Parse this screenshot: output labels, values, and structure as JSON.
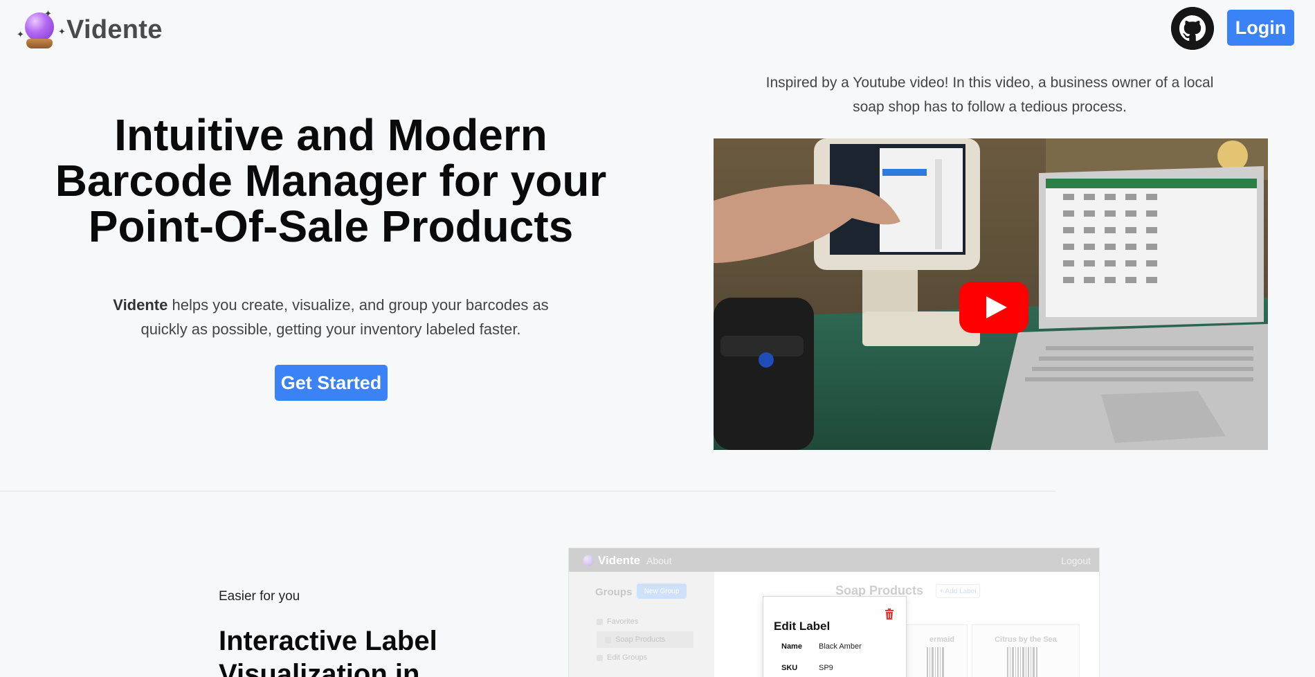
{
  "brand": {
    "name": "Vidente"
  },
  "header": {
    "login_label": "Login",
    "github_label": "GitHub"
  },
  "hero": {
    "title_lines": [
      "Intuitive and Modern",
      "Barcode Manager for your",
      "Point-Of-Sale Products"
    ],
    "desc_brand": "Vidente",
    "desc_rest": " helps you create, visualize, and group your barcodes as quickly as possible, getting your inventory labeled faster.",
    "cta_label": "Get Started"
  },
  "video": {
    "caption": "Inspired by a Youtube video! In this video, a business owner of a local soap shop has to follow a tedious process."
  },
  "feature": {
    "kicker": "Easier for you",
    "title": "Interactive Label Visualization in"
  },
  "preview": {
    "nav": {
      "brand": "Vidente",
      "about": "About",
      "logout": "Logout"
    },
    "sidebar": {
      "title": "Groups",
      "new_group": "New Group",
      "items": [
        "Favorites",
        "Soap Products",
        "Edit Groups"
      ]
    },
    "main": {
      "title": "Soap Products",
      "add_label": "+ Add Label",
      "cards": [
        "ermaid",
        "Citrus by the Sea"
      ]
    },
    "edit_label": {
      "title": "Edit Label",
      "fields": [
        {
          "key": "Name",
          "value": "Black Amber"
        },
        {
          "key": "SKU",
          "value": "SP9"
        }
      ]
    }
  },
  "colors": {
    "accent": "#3b82f6",
    "play": "#ff0000",
    "delete": "#e53935"
  }
}
